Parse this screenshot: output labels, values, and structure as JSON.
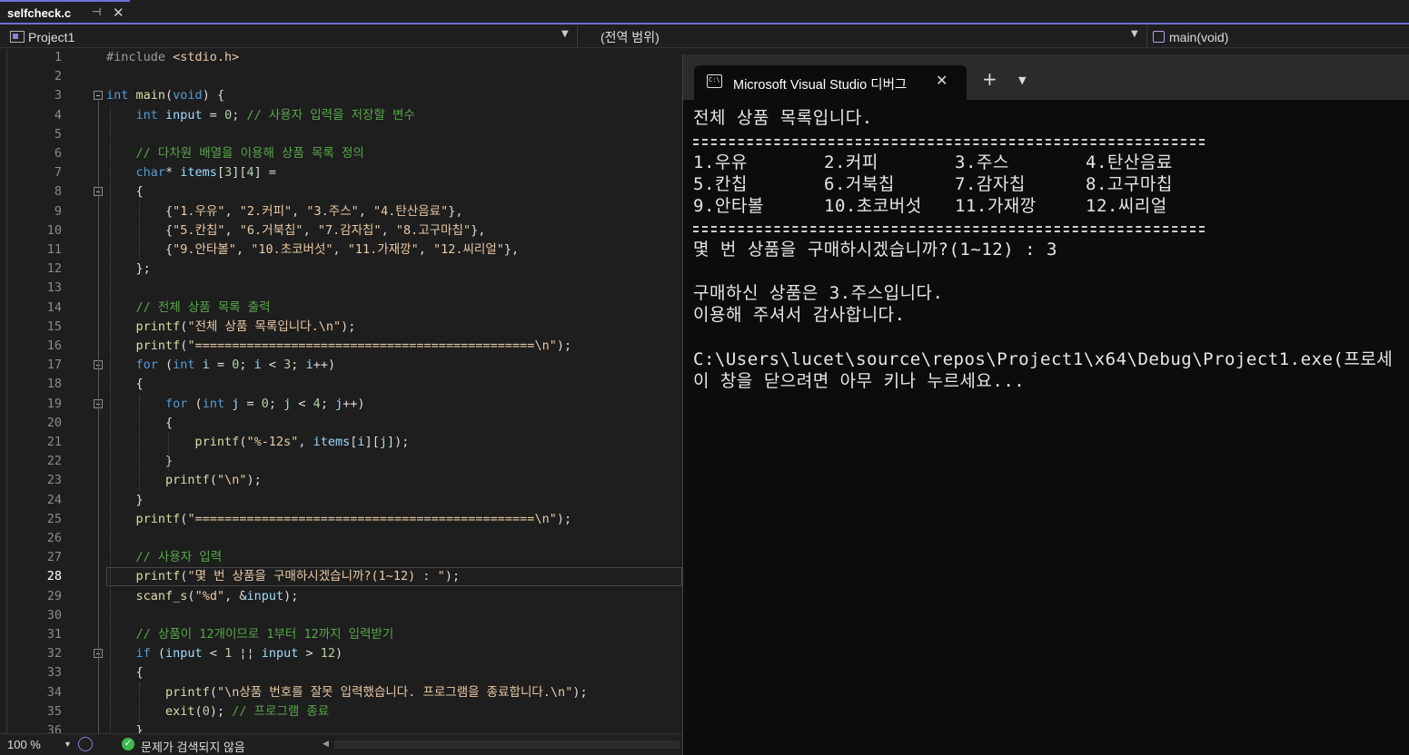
{
  "tab": {
    "title": "selfcheck.c",
    "pin": "⊣",
    "close": "✕"
  },
  "nav": {
    "project": "Project1",
    "scope": "(전역 범위)",
    "member": "main(void)"
  },
  "editor": {
    "current_line": 28,
    "lines": [
      {
        "n": "1",
        "segs": [
          [
            "pp",
            "#include "
          ],
          [
            "st",
            "<stdio.h>"
          ]
        ]
      },
      {
        "n": "2",
        "segs": []
      },
      {
        "n": "3",
        "segs": [
          [
            "kw",
            "int "
          ],
          [
            "fn",
            "main"
          ],
          [
            "pl",
            "("
          ],
          [
            "kw",
            "void"
          ],
          [
            "pl",
            ") {"
          ]
        ]
      },
      {
        "n": "4",
        "segs": [
          [
            "pl",
            "    "
          ],
          [
            "kw",
            "int "
          ],
          [
            "var",
            "input"
          ],
          [
            "pl",
            " = "
          ],
          [
            "num",
            "0"
          ],
          [
            "pl",
            "; "
          ],
          [
            "cm",
            "// 사용자 입력을 저장할 변수"
          ]
        ]
      },
      {
        "n": "5",
        "segs": []
      },
      {
        "n": "6",
        "segs": [
          [
            "pl",
            "    "
          ],
          [
            "cm",
            "// 다차원 배열을 이용해 상품 목록 정의"
          ]
        ]
      },
      {
        "n": "7",
        "segs": [
          [
            "pl",
            "    "
          ],
          [
            "kw",
            "char"
          ],
          [
            "pl",
            "* "
          ],
          [
            "var",
            "items"
          ],
          [
            "pl",
            "["
          ],
          [
            "num",
            "3"
          ],
          [
            "pl",
            "]["
          ],
          [
            "num",
            "4"
          ],
          [
            "pl",
            "] ="
          ]
        ]
      },
      {
        "n": "8",
        "segs": [
          [
            "pl",
            "    {"
          ]
        ]
      },
      {
        "n": "9",
        "segs": [
          [
            "pl",
            "        {"
          ],
          [
            "st",
            "\"1.우유\""
          ],
          [
            "pl",
            ", "
          ],
          [
            "st",
            "\"2.커피\""
          ],
          [
            "pl",
            ", "
          ],
          [
            "st",
            "\"3.주스\""
          ],
          [
            "pl",
            ", "
          ],
          [
            "st",
            "\"4.탄산음료\""
          ],
          [
            "pl",
            "},"
          ]
        ]
      },
      {
        "n": "10",
        "segs": [
          [
            "pl",
            "        {"
          ],
          [
            "st",
            "\"5.칸칩\""
          ],
          [
            "pl",
            ", "
          ],
          [
            "st",
            "\"6.거북칩\""
          ],
          [
            "pl",
            ", "
          ],
          [
            "st",
            "\"7.감자칩\""
          ],
          [
            "pl",
            ", "
          ],
          [
            "st",
            "\"8.고구마칩\""
          ],
          [
            "pl",
            "},"
          ]
        ]
      },
      {
        "n": "11",
        "segs": [
          [
            "pl",
            "        {"
          ],
          [
            "st",
            "\"9.안타볼\""
          ],
          [
            "pl",
            ", "
          ],
          [
            "st",
            "\"10.초코버섯\""
          ],
          [
            "pl",
            ", "
          ],
          [
            "st",
            "\"11.가재깡\""
          ],
          [
            "pl",
            ", "
          ],
          [
            "st",
            "\"12.씨리얼\""
          ],
          [
            "pl",
            "},"
          ]
        ]
      },
      {
        "n": "12",
        "segs": [
          [
            "pl",
            "    };"
          ]
        ]
      },
      {
        "n": "13",
        "segs": []
      },
      {
        "n": "14",
        "segs": [
          [
            "pl",
            "    "
          ],
          [
            "cm",
            "// 전체 상품 목록 출력"
          ]
        ]
      },
      {
        "n": "15",
        "segs": [
          [
            "pl",
            "    "
          ],
          [
            "fn",
            "printf"
          ],
          [
            "pl",
            "("
          ],
          [
            "st",
            "\"전체 상품 목록입니다."
          ],
          [
            "esc",
            "\\n"
          ],
          [
            "st",
            "\""
          ],
          [
            "pl",
            ");"
          ]
        ]
      },
      {
        "n": "16",
        "segs": [
          [
            "pl",
            "    "
          ],
          [
            "fn",
            "printf"
          ],
          [
            "pl",
            "("
          ],
          [
            "st",
            "\"=============================================="
          ],
          [
            "esc",
            "\\n"
          ],
          [
            "st",
            "\""
          ],
          [
            "pl",
            ");"
          ]
        ]
      },
      {
        "n": "17",
        "segs": [
          [
            "pl",
            "    "
          ],
          [
            "kw",
            "for"
          ],
          [
            "pl",
            " ("
          ],
          [
            "kw",
            "int "
          ],
          [
            "var",
            "i"
          ],
          [
            "pl",
            " = "
          ],
          [
            "num",
            "0"
          ],
          [
            "pl",
            "; "
          ],
          [
            "var",
            "i"
          ],
          [
            "pl",
            " < "
          ],
          [
            "num",
            "3"
          ],
          [
            "pl",
            "; "
          ],
          [
            "var",
            "i"
          ],
          [
            "pl",
            "++)"
          ]
        ]
      },
      {
        "n": "18",
        "segs": [
          [
            "pl",
            "    {"
          ]
        ]
      },
      {
        "n": "19",
        "segs": [
          [
            "pl",
            "        "
          ],
          [
            "kw",
            "for"
          ],
          [
            "pl",
            " ("
          ],
          [
            "kw",
            "int "
          ],
          [
            "var",
            "j"
          ],
          [
            "pl",
            " = "
          ],
          [
            "num",
            "0"
          ],
          [
            "pl",
            "; "
          ],
          [
            "var",
            "j"
          ],
          [
            "pl",
            " < "
          ],
          [
            "num",
            "4"
          ],
          [
            "pl",
            "; "
          ],
          [
            "var",
            "j"
          ],
          [
            "pl",
            "++)"
          ]
        ]
      },
      {
        "n": "20",
        "segs": [
          [
            "pl",
            "        {"
          ]
        ]
      },
      {
        "n": "21",
        "segs": [
          [
            "pl",
            "            "
          ],
          [
            "fn",
            "printf"
          ],
          [
            "pl",
            "("
          ],
          [
            "st",
            "\"%-12s\""
          ],
          [
            "pl",
            ", "
          ],
          [
            "var",
            "items"
          ],
          [
            "pl",
            "["
          ],
          [
            "var",
            "i"
          ],
          [
            "pl",
            "]["
          ],
          [
            "var",
            "j"
          ],
          [
            "pl",
            "]);"
          ]
        ]
      },
      {
        "n": "22",
        "segs": [
          [
            "pl",
            "        }"
          ]
        ]
      },
      {
        "n": "23",
        "segs": [
          [
            "pl",
            "        "
          ],
          [
            "fn",
            "printf"
          ],
          [
            "pl",
            "("
          ],
          [
            "st",
            "\""
          ],
          [
            "esc",
            "\\n"
          ],
          [
            "st",
            "\""
          ],
          [
            "pl",
            ");"
          ]
        ]
      },
      {
        "n": "24",
        "segs": [
          [
            "pl",
            "    }"
          ]
        ]
      },
      {
        "n": "25",
        "segs": [
          [
            "pl",
            "    "
          ],
          [
            "fn",
            "printf"
          ],
          [
            "pl",
            "("
          ],
          [
            "st",
            "\"=============================================="
          ],
          [
            "esc",
            "\\n"
          ],
          [
            "st",
            "\""
          ],
          [
            "pl",
            ");"
          ]
        ]
      },
      {
        "n": "26",
        "segs": []
      },
      {
        "n": "27",
        "segs": [
          [
            "pl",
            "    "
          ],
          [
            "cm",
            "// 사용자 입력"
          ]
        ]
      },
      {
        "n": "28",
        "segs": [
          [
            "pl",
            "    "
          ],
          [
            "fn",
            "printf"
          ],
          [
            "pl",
            "("
          ],
          [
            "st",
            "\"몇 번 상품을 구매하시겠습니까?(1~12) : \""
          ],
          [
            "pl",
            ");"
          ]
        ]
      },
      {
        "n": "29",
        "segs": [
          [
            "pl",
            "    "
          ],
          [
            "fn",
            "scanf_s"
          ],
          [
            "pl",
            "("
          ],
          [
            "st",
            "\"%d\""
          ],
          [
            "pl",
            ", &"
          ],
          [
            "var",
            "input"
          ],
          [
            "pl",
            ");"
          ]
        ]
      },
      {
        "n": "30",
        "segs": []
      },
      {
        "n": "31",
        "segs": [
          [
            "pl",
            "    "
          ],
          [
            "cm",
            "// 상품이 12개이므로 1부터 12까지 입력받기"
          ]
        ]
      },
      {
        "n": "32",
        "segs": [
          [
            "pl",
            "    "
          ],
          [
            "kw",
            "if"
          ],
          [
            "pl",
            " ("
          ],
          [
            "var",
            "input"
          ],
          [
            "pl",
            " < "
          ],
          [
            "num",
            "1"
          ],
          [
            "pl",
            " ¦¦ "
          ],
          [
            "var",
            "input"
          ],
          [
            "pl",
            " > "
          ],
          [
            "num",
            "12"
          ],
          [
            "pl",
            ")"
          ]
        ]
      },
      {
        "n": "33",
        "segs": [
          [
            "pl",
            "    {"
          ]
        ]
      },
      {
        "n": "34",
        "segs": [
          [
            "pl",
            "        "
          ],
          [
            "fn",
            "printf"
          ],
          [
            "pl",
            "("
          ],
          [
            "st",
            "\""
          ],
          [
            "esc",
            "\\n"
          ],
          [
            "st",
            "상품 번호를 잘못 입력했습니다. 프로그램을 종료합니다."
          ],
          [
            "esc",
            "\\n"
          ],
          [
            "st",
            "\""
          ],
          [
            "pl",
            ");"
          ]
        ]
      },
      {
        "n": "35",
        "segs": [
          [
            "pl",
            "        "
          ],
          [
            "fn",
            "exit"
          ],
          [
            "pl",
            "("
          ],
          [
            "num",
            "0"
          ],
          [
            "pl",
            "); "
          ],
          [
            "cm",
            "// 프로그램 종료"
          ]
        ]
      },
      {
        "n": "36",
        "segs": [
          [
            "pl",
            "    }"
          ]
        ]
      }
    ]
  },
  "status": {
    "zoom": "100 %",
    "issues": "문제가 검색되지 않음"
  },
  "console": {
    "title": "Microsoft Visual Studio 디버그",
    "icon": "C:\\",
    "close": "✕",
    "plus": "+",
    "chevron": "⌄",
    "header": "전체 상품 목록입니다.",
    "rows": [
      [
        "1.우유",
        "2.커피",
        "3.주스",
        "4.탄산음료"
      ],
      [
        "5.칸칩",
        "6.거북칩",
        "7.감자칩",
        "8.고구마칩"
      ],
      [
        "9.안타볼",
        "10.초코버섯",
        "11.가재깡",
        "12.씨리얼"
      ]
    ],
    "prompt": "몇 번 상품을 구매하시겠습니까?(1~12) : 3",
    "result1": "구매하신 상품은 3.주스입니다.",
    "result2": "이용해 주셔서 감사합니다.",
    "exit1": "C:\\Users\\lucet\\source\\repos\\Project1\\x64\\Debug\\Project1.exe(프로세",
    "exit2": "이 창을 닫으려면 아무 키나 누르세요..."
  }
}
